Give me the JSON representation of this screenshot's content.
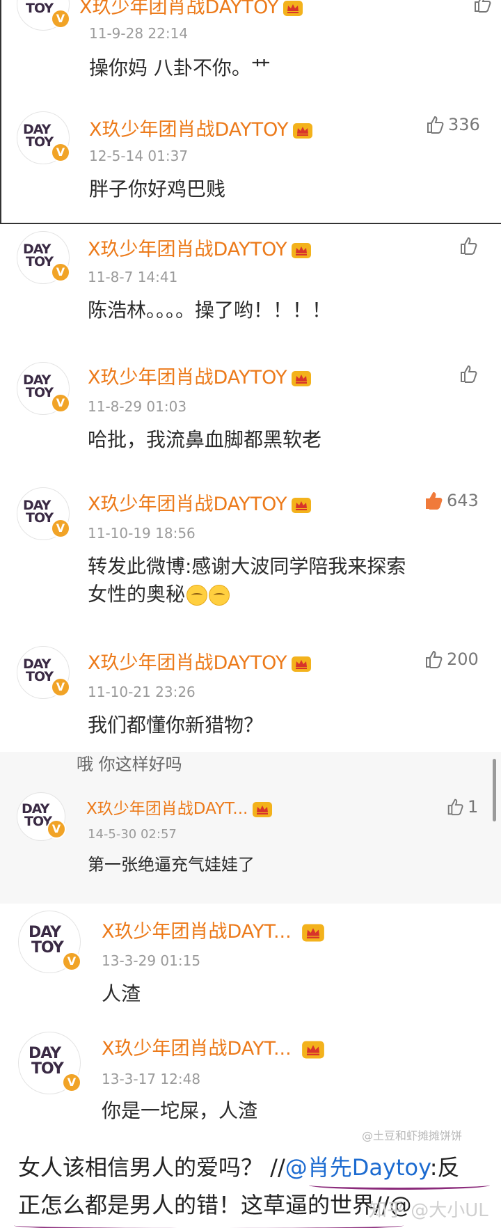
{
  "user_name": "X玖少年团肖战DAYTOY",
  "user_name_truncated": "X玖少年团肖战DAYT...",
  "avatar_text": [
    "DAY",
    "TOY"
  ],
  "avatar_badge": "V",
  "comments": [
    {
      "time": "11-9-28 22:14",
      "text": "操你妈  八卦不你。艹",
      "likes": ""
    },
    {
      "time": "12-5-14 01:37",
      "text": "胖子你好鸡巴贱",
      "likes": "336"
    },
    {
      "time": "11-8-7 14:41",
      "text": "陈浩林。。。。操了哟！！！！",
      "likes": ""
    },
    {
      "time": "11-8-29 01:03",
      "text": "哈批，我流鼻血脚都黑软老",
      "likes": ""
    },
    {
      "time": "11-10-19 18:56",
      "text": "转发此微博:感谢大波同学陪我来探索",
      "text_line2": "女性的奥秘",
      "likes": "643"
    },
    {
      "time": "11-10-21 23:26",
      "text": "我们都懂你新猎物？",
      "likes": "200"
    },
    {
      "time": "14-5-30 02:57",
      "text": "第一张绝逼充气娃娃了",
      "likes": "1",
      "clipped_above": "哦 你这样好吗"
    },
    {
      "time": "13-3-29 01:15",
      "text": "人渣",
      "likes": ""
    },
    {
      "time": "13-3-17 12:48",
      "text": "你是一坨屎，人渣",
      "likes": ""
    }
  ],
  "footer": {
    "line1_prefix": "女人该相信男人的爱吗？ //",
    "mention": "@肖先Daytoy",
    "line1_suffix": ":反",
    "line2": "正怎么都是男人的错！这草逼的世界",
    "line2_tail": "//@"
  },
  "watermarks": {
    "weibo": "@土豆和虾摊摊饼饼",
    "zhihu": "知乎 @大小UL"
  },
  "colors": {
    "name": "#ec7a1a",
    "like_active": "#f07a3a",
    "mention": "#1c6bd0"
  }
}
